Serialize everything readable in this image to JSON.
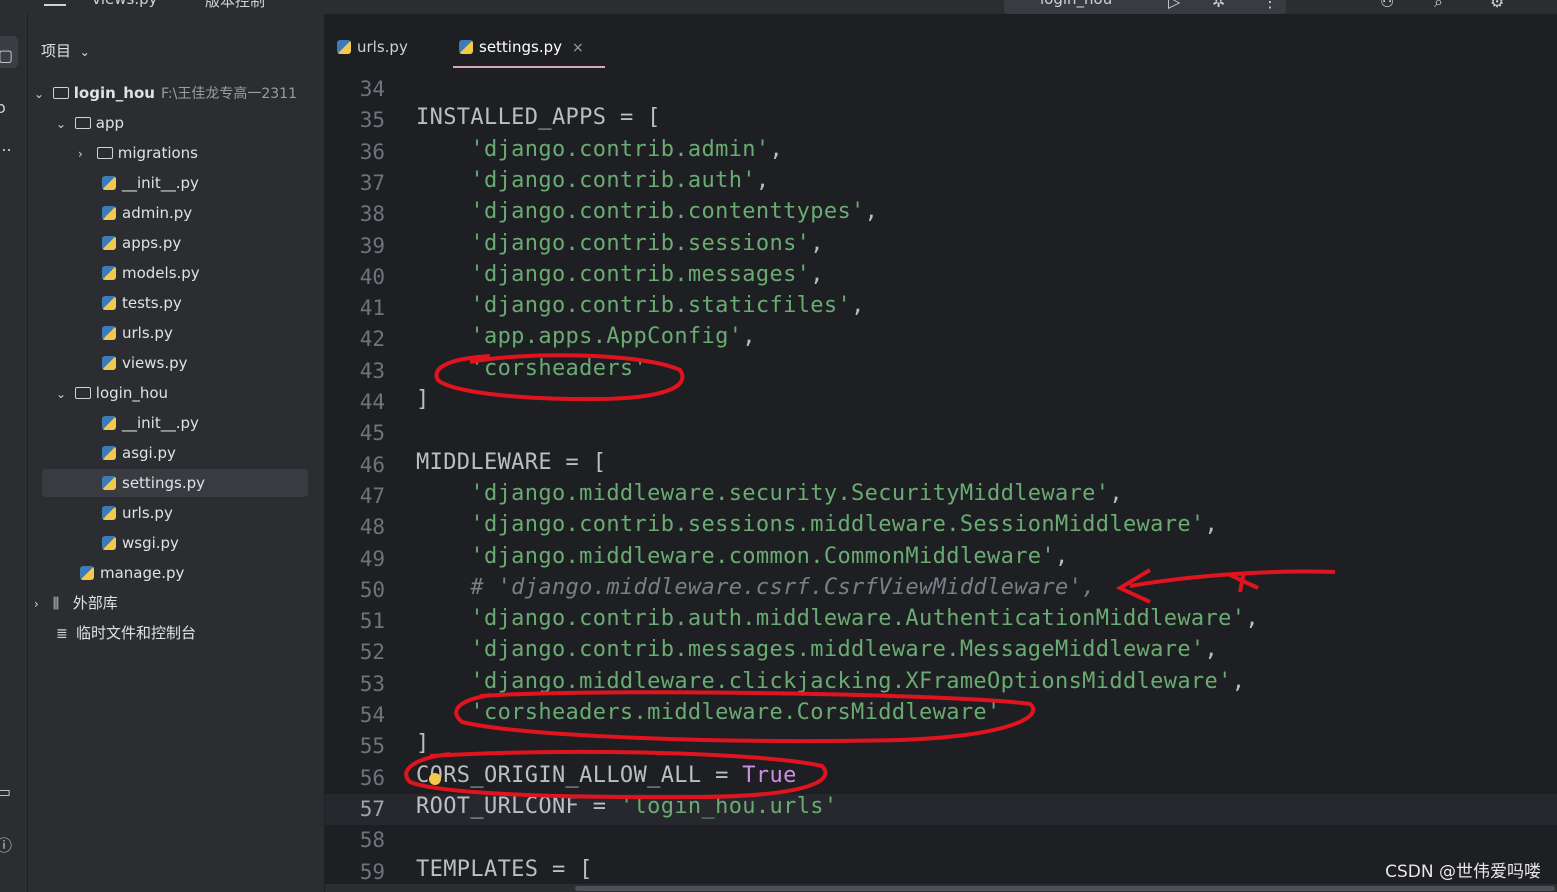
{
  "topbar": {
    "current_file": "views.py",
    "branch": "版本控制",
    "run_config": "login_hou"
  },
  "toolstrip": {
    "icons": [
      "project-icon",
      "commit-icon",
      "more-icon",
      "terminal-icon",
      "problems-icon"
    ]
  },
  "project": {
    "header_label": "项目",
    "root_name": "login_hou",
    "root_path": "F:\\王佳龙专高一2311",
    "items": [
      {
        "label": "app",
        "kind": "folder"
      },
      {
        "label": "migrations",
        "kind": "folder"
      },
      {
        "label": "__init__.py",
        "kind": "py"
      },
      {
        "label": "admin.py",
        "kind": "py"
      },
      {
        "label": "apps.py",
        "kind": "py"
      },
      {
        "label": "models.py",
        "kind": "py"
      },
      {
        "label": "tests.py",
        "kind": "py"
      },
      {
        "label": "urls.py",
        "kind": "py"
      },
      {
        "label": "views.py",
        "kind": "py"
      },
      {
        "label": "login_hou",
        "kind": "folder"
      },
      {
        "label": "__init__.py",
        "kind": "py"
      },
      {
        "label": "asgi.py",
        "kind": "py"
      },
      {
        "label": "settings.py",
        "kind": "py",
        "selected": true
      },
      {
        "label": "urls.py",
        "kind": "py"
      },
      {
        "label": "wsgi.py",
        "kind": "py"
      },
      {
        "label": "manage.py",
        "kind": "py"
      },
      {
        "label": "外部库",
        "kind": "lib"
      },
      {
        "label": "临时文件和控制台",
        "kind": "scratch"
      }
    ]
  },
  "editor": {
    "tabs": [
      {
        "label": "urls.py",
        "active": false
      },
      {
        "label": "settings.py",
        "active": true,
        "close": "×"
      }
    ],
    "lines": [
      {
        "n": "34",
        "parts": []
      },
      {
        "n": "35",
        "parts": [
          [
            "var",
            "INSTALLED_APPS"
          ],
          [
            "op",
            " = ["
          ]
        ]
      },
      {
        "n": "36",
        "parts": [
          [
            "op",
            "    "
          ],
          [
            "str",
            "'django.contrib.admin'"
          ],
          [
            "op",
            ","
          ]
        ]
      },
      {
        "n": "37",
        "parts": [
          [
            "op",
            "    "
          ],
          [
            "str",
            "'django.contrib.auth'"
          ],
          [
            "op",
            ","
          ]
        ]
      },
      {
        "n": "38",
        "parts": [
          [
            "op",
            "    "
          ],
          [
            "str",
            "'django.contrib.contenttypes'"
          ],
          [
            "op",
            ","
          ]
        ]
      },
      {
        "n": "39",
        "parts": [
          [
            "op",
            "    "
          ],
          [
            "str",
            "'django.contrib.sessions'"
          ],
          [
            "op",
            ","
          ]
        ]
      },
      {
        "n": "40",
        "parts": [
          [
            "op",
            "    "
          ],
          [
            "str",
            "'django.contrib.messages'"
          ],
          [
            "op",
            ","
          ]
        ]
      },
      {
        "n": "41",
        "parts": [
          [
            "op",
            "    "
          ],
          [
            "str",
            "'django.contrib.staticfiles'"
          ],
          [
            "op",
            ","
          ]
        ]
      },
      {
        "n": "42",
        "parts": [
          [
            "op",
            "    "
          ],
          [
            "str",
            "'app.apps.AppConfig'"
          ],
          [
            "op",
            ","
          ]
        ]
      },
      {
        "n": "43",
        "parts": [
          [
            "op",
            "    "
          ],
          [
            "str",
            "'corsheaders'"
          ]
        ]
      },
      {
        "n": "44",
        "parts": [
          [
            "op",
            "]"
          ]
        ]
      },
      {
        "n": "45",
        "parts": []
      },
      {
        "n": "46",
        "parts": [
          [
            "var",
            "MIDDLEWARE"
          ],
          [
            "op",
            " = ["
          ]
        ]
      },
      {
        "n": "47",
        "parts": [
          [
            "op",
            "    "
          ],
          [
            "str",
            "'django.middleware.security.SecurityMiddleware'"
          ],
          [
            "op",
            ","
          ]
        ]
      },
      {
        "n": "48",
        "parts": [
          [
            "op",
            "    "
          ],
          [
            "str",
            "'django.contrib.sessions.middleware.SessionMiddleware'"
          ],
          [
            "op",
            ","
          ]
        ]
      },
      {
        "n": "49",
        "parts": [
          [
            "op",
            "    "
          ],
          [
            "str",
            "'django.middleware.common.CommonMiddleware'"
          ],
          [
            "op",
            ","
          ]
        ]
      },
      {
        "n": "50",
        "parts": [
          [
            "op",
            "    "
          ],
          [
            "cmt",
            "# 'django.middleware.csrf.CsrfViewMiddleware',"
          ]
        ]
      },
      {
        "n": "51",
        "parts": [
          [
            "op",
            "    "
          ],
          [
            "str",
            "'django.contrib.auth.middleware.AuthenticationMiddleware'"
          ],
          [
            "op",
            ","
          ]
        ]
      },
      {
        "n": "52",
        "parts": [
          [
            "op",
            "    "
          ],
          [
            "str",
            "'django.contrib.messages.middleware.MessageMiddleware'"
          ],
          [
            "op",
            ","
          ]
        ]
      },
      {
        "n": "53",
        "parts": [
          [
            "op",
            "    "
          ],
          [
            "str",
            "'django.middleware.clickjacking.XFrameOptionsMiddleware'"
          ],
          [
            "op",
            ","
          ]
        ]
      },
      {
        "n": "54",
        "parts": [
          [
            "op",
            "    "
          ],
          [
            "str",
            "'corsheaders.middleware.CorsMiddleware'"
          ]
        ]
      },
      {
        "n": "55",
        "parts": [
          [
            "op",
            "]"
          ]
        ]
      },
      {
        "n": "56",
        "parts": [
          [
            "var",
            "CORS_ORIGIN_ALLOW_ALL"
          ],
          [
            "op",
            " = "
          ],
          [
            "true",
            "True"
          ]
        ]
      },
      {
        "n": "57",
        "parts": [
          [
            "var",
            "ROOT_URLCONF"
          ],
          [
            "op",
            " = "
          ],
          [
            "str",
            "'login_hou.urls'"
          ]
        ],
        "current": true
      },
      {
        "n": "58",
        "parts": []
      },
      {
        "n": "59",
        "parts": [
          [
            "var",
            "TEMPLATES"
          ],
          [
            "op",
            " = ["
          ]
        ]
      }
    ]
  },
  "watermark": "CSDN @世伟爱吗喽",
  "colors": {
    "background": "#1e1f22",
    "panel": "#2b2d30",
    "string": "#6aab73",
    "comment": "#7a7e85",
    "keyword_true": "#cf8ee6",
    "annotation_red": "#e0141e"
  }
}
